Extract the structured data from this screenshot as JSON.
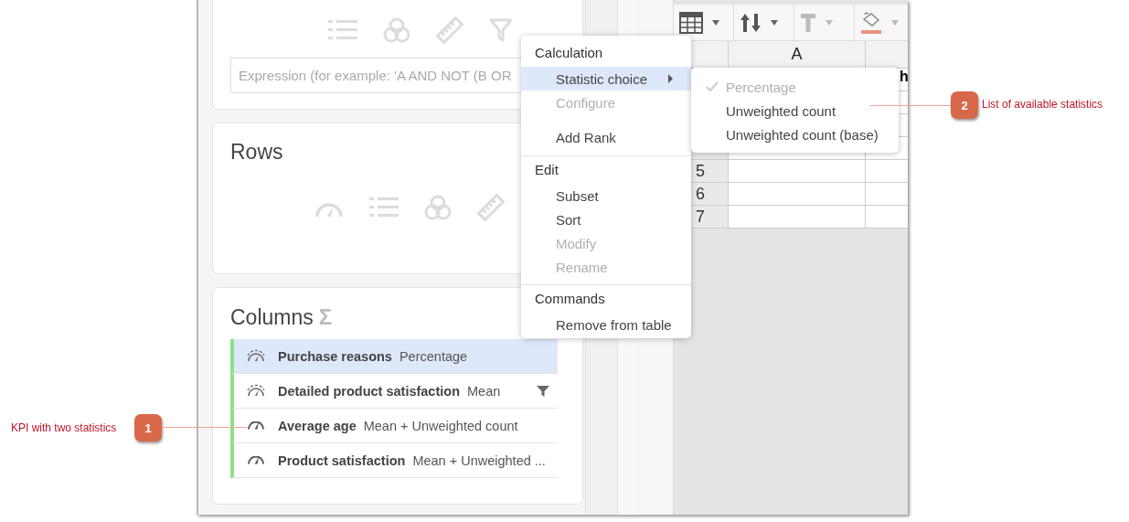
{
  "filter_card": {
    "expression": {
      "placeholder": "Expression (for example: 'A AND NOT (B OR"
    }
  },
  "rows_card": {
    "title": "Rows"
  },
  "columns_card": {
    "title": "Columns",
    "sigma": "Σ",
    "items": [
      {
        "name": "Purchase reasons",
        "statistic": "Percentage",
        "kind": "waves",
        "selected": true,
        "filtered": false
      },
      {
        "name": "Detailed product satisfaction",
        "statistic": "Mean",
        "kind": "waves",
        "selected": false,
        "filtered": true
      },
      {
        "name": "Average age",
        "statistic": "Mean + Unweighted count",
        "kind": "gauge",
        "selected": false,
        "filtered": false
      },
      {
        "name": "Product satisfaction",
        "statistic": "Mean + Unweighted ...",
        "kind": "gauge",
        "selected": false,
        "filtered": false
      }
    ]
  },
  "sheet": {
    "column_headers": [
      "A"
    ],
    "rows": [
      {
        "number": "",
        "cell_b": "h"
      },
      {
        "number": "",
        "cell_b": ""
      },
      {
        "number": "",
        "cell_b": ""
      },
      {
        "number": "",
        "cell_b": ""
      },
      {
        "number": "5",
        "cell_b": ""
      },
      {
        "number": "6",
        "cell_b": ""
      },
      {
        "number": "7",
        "cell_b": ""
      }
    ]
  },
  "context_menu": {
    "sections": [
      {
        "title": "Calculation",
        "items": [
          {
            "label": "Statistic choice",
            "selected": true,
            "disabled": false,
            "submenu": true,
            "gap_before": false
          },
          {
            "label": "Configure",
            "selected": false,
            "disabled": true,
            "submenu": false,
            "gap_before": false
          },
          {
            "label": "Add Rank",
            "selected": false,
            "disabled": false,
            "submenu": false,
            "gap_before": true
          }
        ]
      },
      {
        "title": "Edit",
        "items": [
          {
            "label": "Subset",
            "selected": false,
            "disabled": false,
            "submenu": false,
            "gap_before": false
          },
          {
            "label": "Sort",
            "selected": false,
            "disabled": false,
            "submenu": false,
            "gap_before": false
          },
          {
            "label": "Modify",
            "selected": false,
            "disabled": true,
            "submenu": false,
            "gap_before": false
          },
          {
            "label": "Rename",
            "selected": false,
            "disabled": true,
            "submenu": false,
            "gap_before": false
          }
        ]
      },
      {
        "title": "Commands",
        "items": [
          {
            "label": "Remove from table",
            "selected": false,
            "disabled": false,
            "submenu": false,
            "gap_before": false
          }
        ]
      }
    ]
  },
  "statistic_submenu": {
    "items": [
      {
        "label": "Percentage",
        "checked": true,
        "disabled": true
      },
      {
        "label": "Unweighted count",
        "checked": false,
        "disabled": false
      },
      {
        "label": "Unweighted count (base)",
        "checked": false,
        "disabled": false
      }
    ]
  },
  "callouts": [
    {
      "number": "1",
      "text": "KPI with two statistics"
    },
    {
      "number": "2",
      "text": "List of available statistics"
    }
  ]
}
